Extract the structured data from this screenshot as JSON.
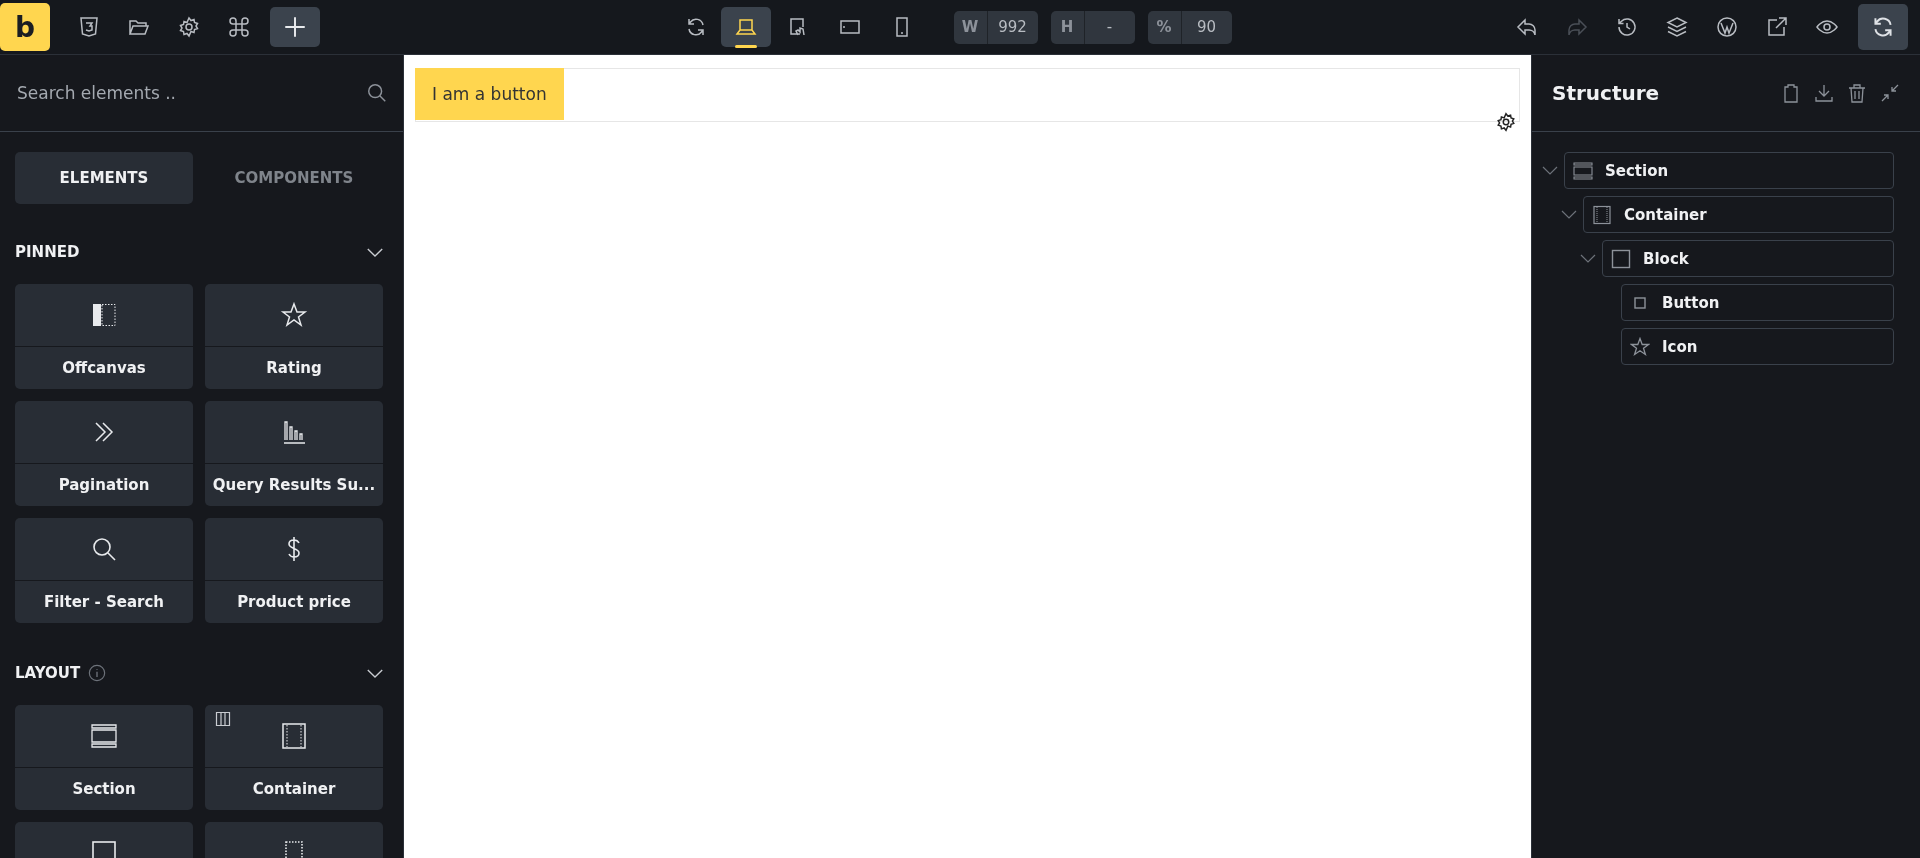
{
  "toolbar": {
    "logo": "b",
    "devices": [
      {
        "kind": "laptop",
        "selected": true
      },
      {
        "kind": "tablet-portrait",
        "selected": false
      },
      {
        "kind": "tablet-landscape",
        "selected": false
      },
      {
        "kind": "phone",
        "selected": false
      }
    ],
    "fields": [
      {
        "label": "W",
        "value": "992"
      },
      {
        "label": "H",
        "value": "-"
      },
      {
        "label": "%",
        "value": "90"
      }
    ],
    "redo_disabled": true
  },
  "elements_panel": {
    "search": {
      "placeholder": "Search elements .."
    },
    "tabs": [
      {
        "label": "ELEMENTS",
        "selected": true
      },
      {
        "label": "COMPONENTS",
        "selected": false
      }
    ],
    "groups": [
      {
        "title": "PINNED",
        "info": false,
        "items": [
          {
            "kind": "offcanvas",
            "label": "Offcanvas"
          },
          {
            "kind": "rating",
            "label": "Rating"
          },
          {
            "kind": "pagination",
            "label": "Pagination"
          },
          {
            "kind": "query-results",
            "label": "Query Results Su..."
          },
          {
            "kind": "search",
            "label": "Filter - Search"
          },
          {
            "kind": "price",
            "label": "Product price"
          }
        ]
      },
      {
        "title": "LAYOUT",
        "info": true,
        "items": [
          {
            "kind": "section",
            "label": "Section"
          },
          {
            "kind": "container",
            "label": "Container"
          },
          {
            "kind": "block"
          },
          {
            "kind": "div"
          }
        ]
      }
    ]
  },
  "canvas": {
    "button": {
      "label": "I am a button"
    }
  },
  "structure": {
    "title": "Structure",
    "items": [
      {
        "kind": "section",
        "label": "Section",
        "expanded": true,
        "children": [
          {
            "kind": "container",
            "label": "Container",
            "expanded": true,
            "children": [
              {
                "kind": "block",
                "label": "Block",
                "expanded": true,
                "children": [
                  {
                    "kind": "button",
                    "label": "Button"
                  },
                  {
                    "kind": "icon",
                    "label": "Icon"
                  }
                ]
              }
            ]
          }
        ]
      }
    ]
  }
}
